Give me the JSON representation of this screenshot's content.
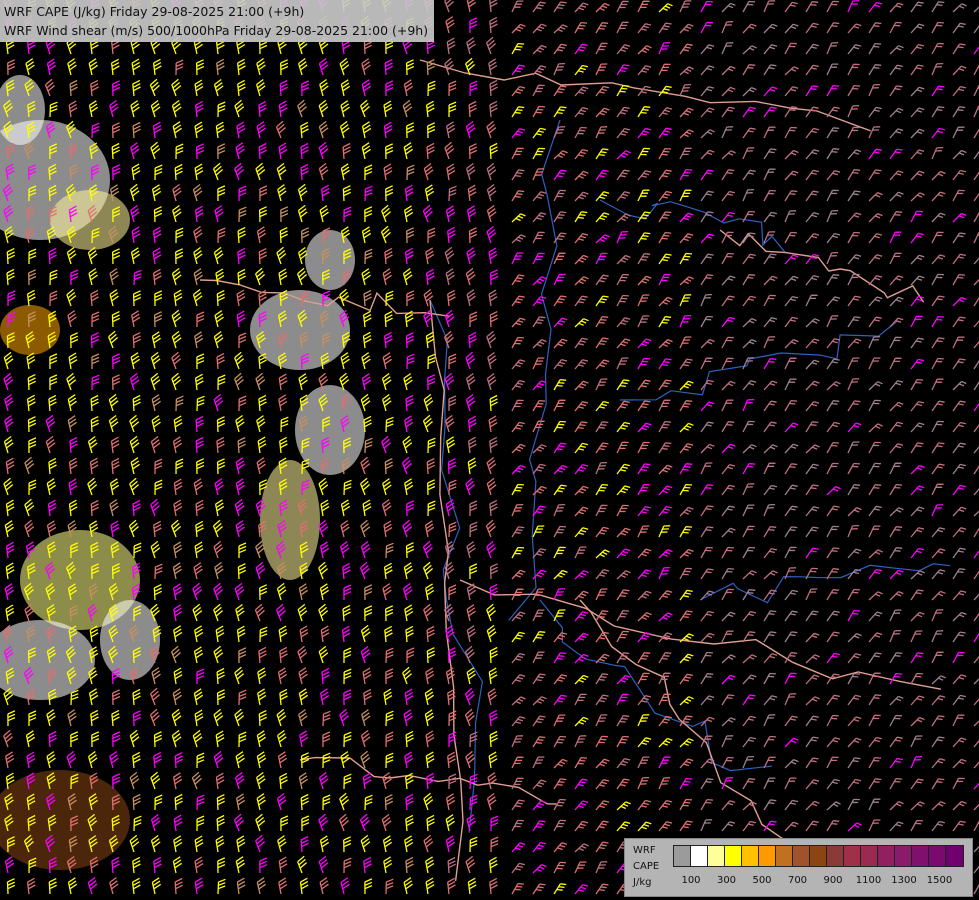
{
  "header": {
    "line1": "WRF CAPE (J/kg) Friday 29-08-2025 21:00 (+9h)",
    "line2": "WRF Wind shear (m/s) 500/1000hPa Friday 29-08-2025 21:00 (+9h)"
  },
  "legend": {
    "label_lines": [
      "WRF",
      "CAPE",
      "J/kg"
    ],
    "colors": [
      "#9b9b9b",
      "#ffffff",
      "#ffff99",
      "#ffff00",
      "#ffc000",
      "#ff9900",
      "#c07020",
      "#a0522d",
      "#8b4513",
      "#8b3a3a",
      "#a0304a",
      "#9a2a50",
      "#902060",
      "#8a1a6a",
      "#80106e",
      "#7a0a70",
      "#700070"
    ],
    "tick_labels": [
      "100",
      "300",
      "500",
      "700",
      "900",
      "1100",
      "1300",
      "1500"
    ]
  },
  "map_style": {
    "background": "#000000",
    "barb_colors": [
      "#ffff00",
      "#ff00ff",
      "#e07070",
      "#c89060",
      "#c07080",
      "#a08090"
    ],
    "border_color": "#e0a090",
    "river_color": "#3060c0"
  }
}
